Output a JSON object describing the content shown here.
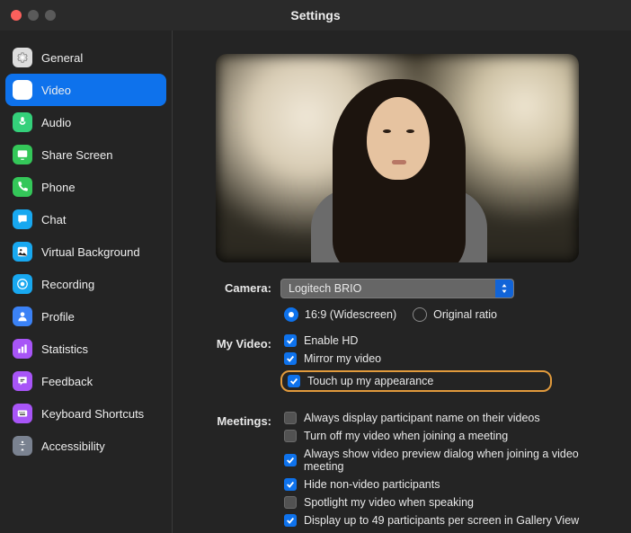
{
  "window": {
    "title": "Settings"
  },
  "sidebar": {
    "items": [
      {
        "label": "General",
        "color": "#dddddd"
      },
      {
        "label": "Video",
        "color": "#ffffff"
      },
      {
        "label": "Audio",
        "color": "#34d07a"
      },
      {
        "label": "Share Screen",
        "color": "#34c759"
      },
      {
        "label": "Phone",
        "color": "#34c759"
      },
      {
        "label": "Chat",
        "color": "#18a8f0"
      },
      {
        "label": "Virtual Background",
        "color": "#18a8f0"
      },
      {
        "label": "Recording",
        "color": "#18a8f0"
      },
      {
        "label": "Profile",
        "color": "#3b82f6"
      },
      {
        "label": "Statistics",
        "color": "#a855f7"
      },
      {
        "label": "Feedback",
        "color": "#a855f7"
      },
      {
        "label": "Keyboard Shortcuts",
        "color": "#a855f7"
      },
      {
        "label": "Accessibility",
        "color": "#7a8290"
      }
    ],
    "activeIndex": 1
  },
  "camera": {
    "label": "Camera:",
    "selected": "Logitech BRIO",
    "aspect": {
      "widescreen": "16:9 (Widescreen)",
      "original": "Original ratio",
      "selected": "widescreen"
    }
  },
  "myVideo": {
    "label": "My Video:",
    "enableHD": {
      "label": "Enable HD",
      "checked": true
    },
    "mirror": {
      "label": "Mirror my video",
      "checked": true
    },
    "touchUp": {
      "label": "Touch up my appearance",
      "checked": true,
      "highlighted": true
    }
  },
  "meetings": {
    "label": "Meetings:",
    "items": [
      {
        "label": "Always display participant name on their videos",
        "checked": false
      },
      {
        "label": "Turn off my video when joining a meeting",
        "checked": false
      },
      {
        "label": "Always show video preview dialog when joining a video meeting",
        "checked": true
      },
      {
        "label": "Hide non-video participants",
        "checked": true
      },
      {
        "label": "Spotlight my video when speaking",
        "checked": false
      },
      {
        "label": "Display up to 49 participants per screen in Gallery View",
        "checked": true
      }
    ]
  }
}
